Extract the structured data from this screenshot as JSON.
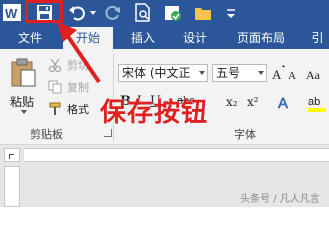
{
  "quick_access": {
    "app_icon": "word-icon",
    "save_icon": "save-icon",
    "undo_icon": "undo-icon",
    "redo_icon": "redo-icon",
    "print_preview_icon": "print-preview-icon",
    "check_icon": "check-icon",
    "folder_icon": "folder-icon",
    "more_icon": "chevron-down-icon"
  },
  "tabs": [
    {
      "label": "文件"
    },
    {
      "label": "开始"
    },
    {
      "label": "插入"
    },
    {
      "label": "设计"
    },
    {
      "label": "页面布局"
    },
    {
      "label": "引"
    }
  ],
  "clipboard": {
    "paste_label": "粘贴",
    "cut_label": "剪切",
    "copy_label": "复制",
    "format_painter_label": "格式",
    "group_label": "剪贴板"
  },
  "font": {
    "font_name": "宋体 (中文正",
    "font_size": "五号",
    "group_label": "字体",
    "format_buttons": [
      "B",
      "I",
      "U",
      "abc",
      "x₂",
      "x²",
      "A",
      "ab",
      "A"
    ]
  },
  "annotation": {
    "text": "保存按钮",
    "color": "#e02020"
  },
  "watermark": {
    "text": "头条号 / 凡人凡言"
  },
  "colors": {
    "brand_blue": "#2b579a",
    "ribbon_bg": "#f3f3f3",
    "highlight_red": "#e02020"
  }
}
